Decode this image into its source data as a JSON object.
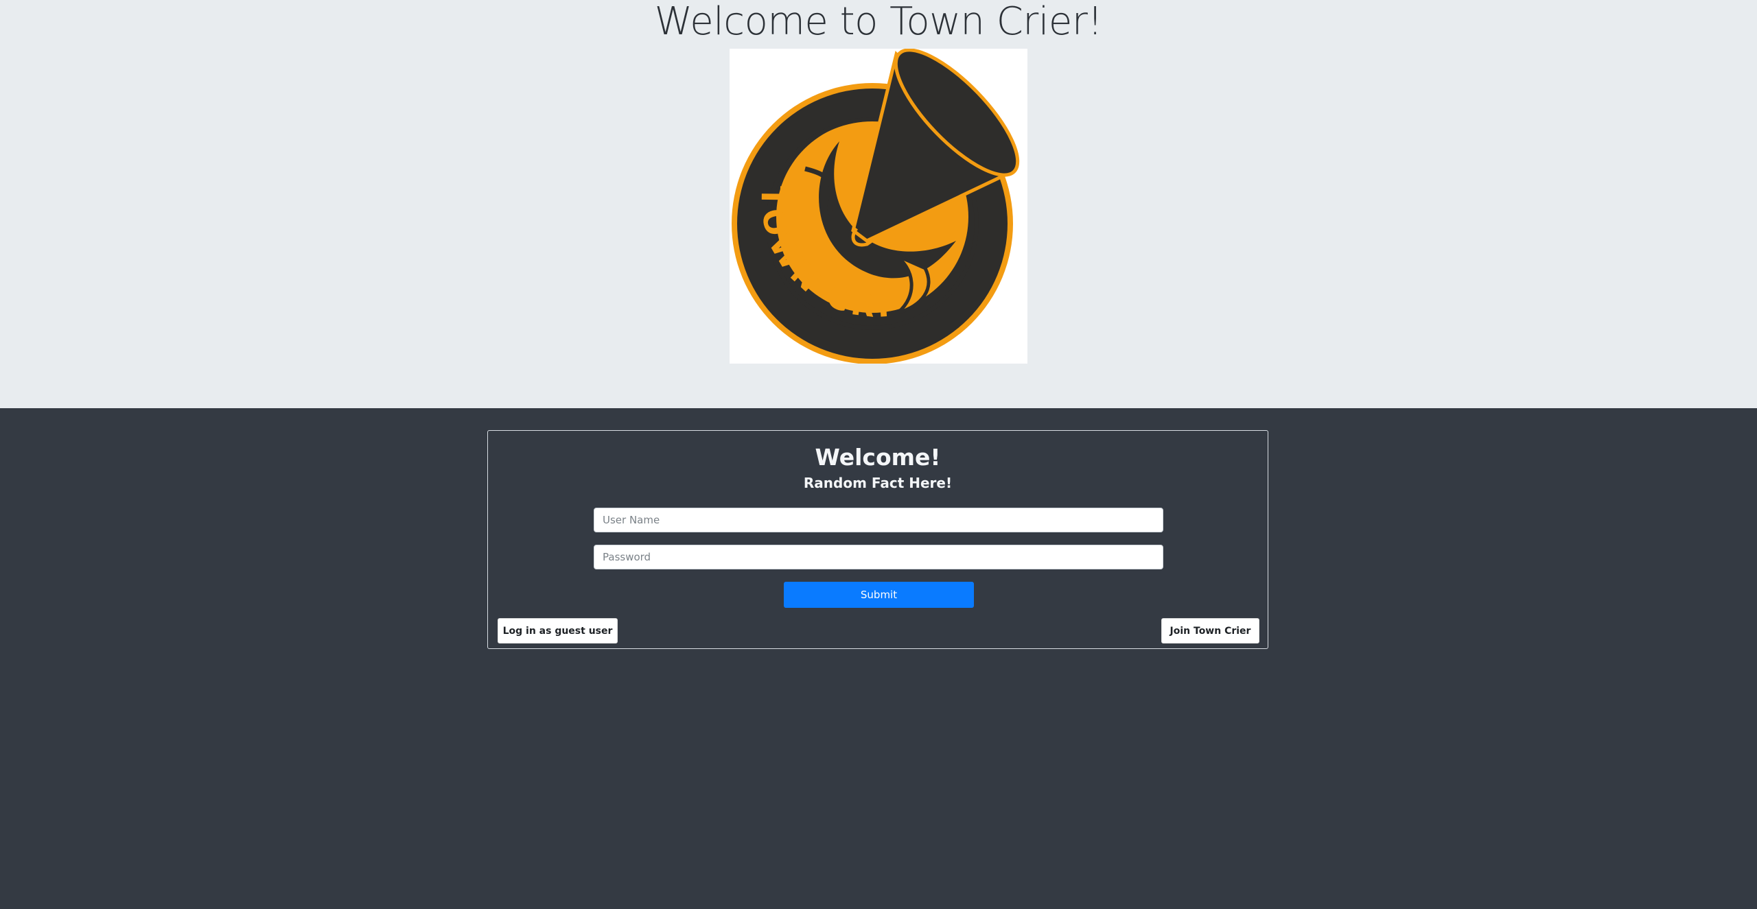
{
  "hero": {
    "title": "Welcome to Town Crier!",
    "logo": {
      "icon": "town-crier-megaphone-logo",
      "text": "TOWN CRIER",
      "colors": {
        "orange": "#f39c12",
        "dark": "#2e2d2b",
        "background": "#ffffff"
      }
    }
  },
  "login_card": {
    "title": "Welcome!",
    "fact": "Random Fact Here!",
    "username": {
      "placeholder": "User Name",
      "value": ""
    },
    "password": {
      "placeholder": "Password",
      "value": ""
    },
    "submit_label": "Submit",
    "guest_label": "Log in as guest user",
    "join_label": "Join Town Crier"
  },
  "colors": {
    "hero_background": "#e8ecef",
    "page_background": "#343a43",
    "submit_button": "#0a7bff",
    "card_border": "#d8dde3"
  }
}
